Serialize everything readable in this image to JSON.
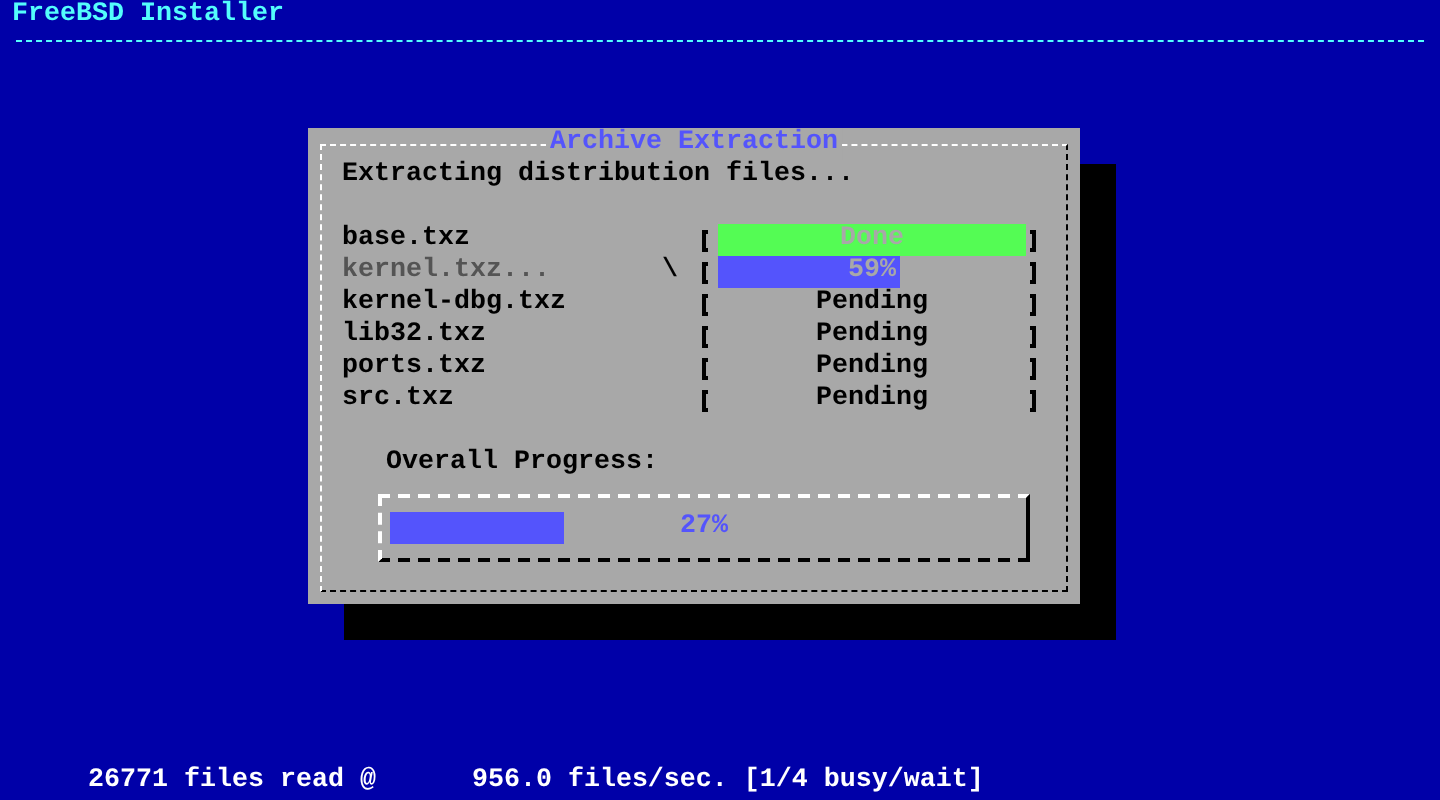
{
  "header": {
    "title": "FreeBSD Installer"
  },
  "dialog": {
    "title": "Archive Extraction",
    "message": "Extracting distribution files...",
    "files": [
      {
        "name": "base.txz",
        "active": false,
        "kind": "done",
        "status": "Done"
      },
      {
        "name": "kernel.txz...",
        "active": true,
        "spinner": "\\",
        "kind": "progress",
        "level": 0.59,
        "status": "59%"
      },
      {
        "name": "kernel-dbg.txz",
        "active": false,
        "kind": "pending",
        "status": "Pending"
      },
      {
        "name": "lib32.txz",
        "active": false,
        "kind": "pending",
        "status": "Pending"
      },
      {
        "name": "ports.txz",
        "active": false,
        "kind": "pending",
        "status": "Pending"
      },
      {
        "name": "src.txz",
        "active": false,
        "kind": "pending",
        "status": "Pending"
      }
    ],
    "overall": {
      "label": "Overall Progress:",
      "level": 0.27,
      "reading": "27%"
    }
  },
  "status_bar": {
    "text": "26771 files read @      956.0 files/sec. [1/4 busy/wait]"
  }
}
